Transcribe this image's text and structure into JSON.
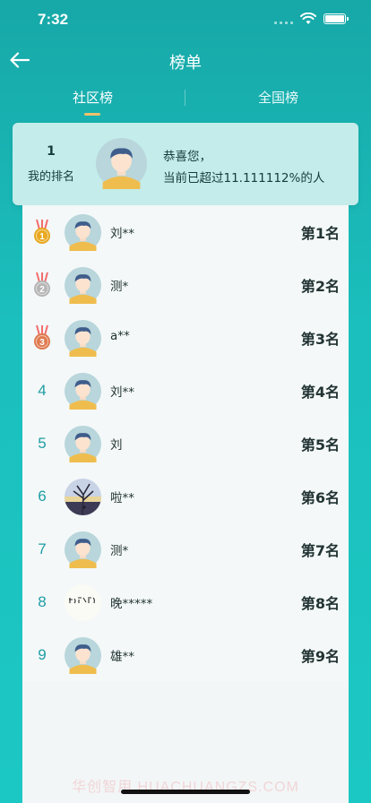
{
  "status_bar": {
    "time": "7:32"
  },
  "nav": {
    "title": "榜单"
  },
  "tabs": [
    {
      "label": "社区榜",
      "active": true
    },
    {
      "label": "全国榜",
      "active": false
    }
  ],
  "my_rank": {
    "rank": "1",
    "label": "我的排名",
    "congrats": "恭喜您，",
    "exceed_text": "当前已超过11.111112%的人"
  },
  "list": [
    {
      "rank": "1",
      "medal": "gold",
      "name": "刘**",
      "place": "第1名",
      "avatar": "default"
    },
    {
      "rank": "2",
      "medal": "silver",
      "name": "测*",
      "place": "第2名",
      "avatar": "default"
    },
    {
      "rank": "3",
      "medal": "bronze",
      "name": "a**",
      "place": "第3名",
      "avatar": "default"
    },
    {
      "rank": "4",
      "medal": "",
      "name": "刘**",
      "place": "第4名",
      "avatar": "default"
    },
    {
      "rank": "5",
      "medal": "",
      "name": "刘",
      "place": "第5名",
      "avatar": "default"
    },
    {
      "rank": "6",
      "medal": "",
      "name": "啦**",
      "place": "第6名",
      "avatar": "photo"
    },
    {
      "rank": "7",
      "medal": "",
      "name": "测*",
      "place": "第7名",
      "avatar": "default"
    },
    {
      "rank": "8",
      "medal": "",
      "name": "晚*****",
      "place": "第8名",
      "avatar": "calligraphy"
    },
    {
      "rank": "9",
      "medal": "",
      "name": "雄**",
      "place": "第9名",
      "avatar": "default"
    }
  ],
  "watermark": "华创智用 HUACHUANGZS.COM",
  "colors": {
    "accent": "#1bbfbd",
    "card": "#c3ecea",
    "rank_text": "#1e9da4",
    "gold": "#e8a820",
    "silver": "#b5b5b5",
    "bronze": "#e07a50",
    "tab_indicator": "#f2c16b"
  }
}
